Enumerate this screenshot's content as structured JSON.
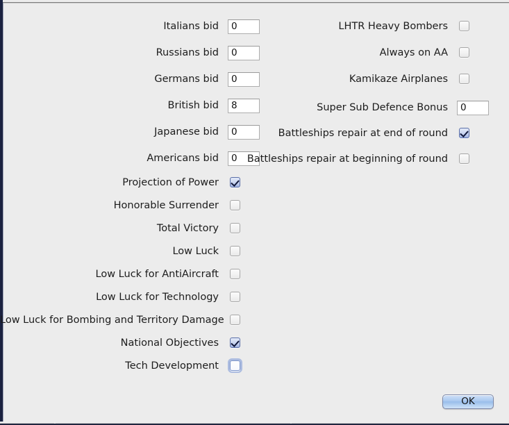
{
  "window": {
    "background_color": "#ececec",
    "edge_color": "#1b2240"
  },
  "left_column": {
    "bid_fields": [
      {
        "label": "Italians bid",
        "value": "0"
      },
      {
        "label": "Russians bid",
        "value": "0"
      },
      {
        "label": "Germans bid",
        "value": "0"
      },
      {
        "label": "British bid",
        "value": "8"
      },
      {
        "label": "Japanese bid",
        "value": "0"
      },
      {
        "label": "Americans bid",
        "value": "0"
      }
    ],
    "options": [
      {
        "label": "Projection of Power",
        "checked": true,
        "focused": false
      },
      {
        "label": "Honorable Surrender",
        "checked": false,
        "focused": false
      },
      {
        "label": "Total Victory",
        "checked": false,
        "focused": false
      },
      {
        "label": "Low Luck",
        "checked": false,
        "focused": false
      },
      {
        "label": "Low Luck for AntiAircraft",
        "checked": false,
        "focused": false
      },
      {
        "label": "Low Luck for Technology",
        "checked": false,
        "focused": false
      },
      {
        "label": "Low Luck for Bombing and Territory Damage",
        "checked": false,
        "focused": false
      },
      {
        "label": "National Objectives",
        "checked": true,
        "focused": false
      },
      {
        "label": "Tech Development",
        "checked": false,
        "focused": true
      }
    ]
  },
  "right_column": {
    "options": [
      {
        "label": "LHTR Heavy Bombers",
        "type": "checkbox",
        "checked": false
      },
      {
        "label": "Always on AA",
        "type": "checkbox",
        "checked": false
      },
      {
        "label": "Kamikaze Airplanes",
        "type": "checkbox",
        "checked": false
      },
      {
        "label": "Super Sub Defence Bonus",
        "type": "field",
        "value": "0"
      },
      {
        "label": "Battleships repair at end of round",
        "type": "checkbox",
        "checked": true
      },
      {
        "label": "Battleships repair at beginning of round",
        "type": "checkbox",
        "checked": false
      }
    ]
  },
  "footer": {
    "ok_label": "OK"
  }
}
